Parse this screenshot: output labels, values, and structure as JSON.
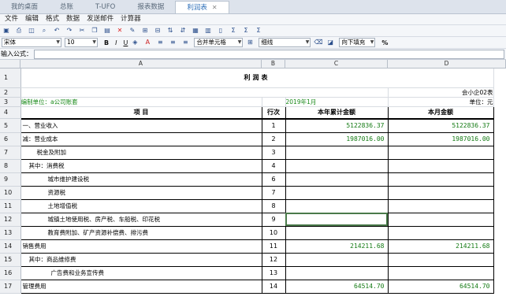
{
  "tabs": [
    {
      "label": "我的桌面",
      "active": false
    },
    {
      "label": "总账",
      "active": false
    },
    {
      "label": "T-UFO",
      "active": false
    },
    {
      "label": "报表数据",
      "active": false
    },
    {
      "label": "利润表",
      "active": true
    }
  ],
  "menu": [
    "文件",
    "编辑",
    "格式",
    "数据",
    "发送邮件",
    "计算器"
  ],
  "format": {
    "font": "宋体",
    "size": "10",
    "bold": "B",
    "italic": "I",
    "underline": "U",
    "merge": "合并单元格",
    "border": "细线",
    "fill": "向下填充",
    "percent": "%"
  },
  "formula": {
    "label": "输入公式：",
    "value": ""
  },
  "columns": {
    "rowhdr": "",
    "a": "A",
    "b": "B",
    "c": "C",
    "d": "D"
  },
  "report": {
    "title": "利润表",
    "form_no": "会小企02表",
    "company": "编制单位：a公司账套",
    "period": "2019年1月",
    "unit": "单位：元",
    "h_item": "项    目",
    "h_row": "行次",
    "h_ytd": "本年累计金额",
    "h_month": "本月金额"
  },
  "rows": [
    {
      "n": "5",
      "item": "一、营业收入",
      "seq": "1",
      "ytd": "5122836.37",
      "month": "5122836.37"
    },
    {
      "n": "6",
      "item": "减：营业成本",
      "seq": "2",
      "ytd": "1987016.00",
      "month": "1987016.00"
    },
    {
      "n": "7",
      "item": "税金及附加",
      "seq": "3",
      "ytd": "",
      "month": ""
    },
    {
      "n": "8",
      "item": "其中：消费税",
      "seq": "4",
      "ytd": "",
      "month": ""
    },
    {
      "n": "9",
      "item": "城市维护建设税",
      "seq": "6",
      "ytd": "",
      "month": ""
    },
    {
      "n": "10",
      "item": "资源税",
      "seq": "7",
      "ytd": "",
      "month": ""
    },
    {
      "n": "11",
      "item": "土地增值税",
      "seq": "8",
      "ytd": "",
      "month": ""
    },
    {
      "n": "12",
      "item": "城镇土地使用税、房产税、车船税、印花税",
      "seq": "9",
      "ytd": "",
      "month": ""
    },
    {
      "n": "13",
      "item": "教育费附加、矿产资源补偿费、排污费",
      "seq": "10",
      "ytd": "",
      "month": ""
    },
    {
      "n": "14",
      "item": "销售费用",
      "seq": "11",
      "ytd": "214211.68",
      "month": "214211.68"
    },
    {
      "n": "15",
      "item": "其中：商品维修费",
      "seq": "12",
      "ytd": "",
      "month": ""
    },
    {
      "n": "16",
      "item": "广告费和业务宣传费",
      "seq": "13",
      "ytd": "",
      "month": ""
    },
    {
      "n": "17",
      "item": "管理费用",
      "seq": "14",
      "ytd": "64514.70",
      "month": "64514.70"
    }
  ],
  "rownums": {
    "r1": "1",
    "r2": "2",
    "r3": "3",
    "r4": "4"
  }
}
